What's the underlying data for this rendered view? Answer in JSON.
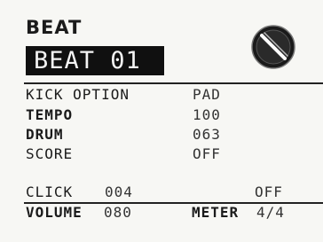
{
  "screen": {
    "title": "BEAT",
    "beat_name": "BEAT 01",
    "knob_icon": "knob-icon"
  },
  "params": [
    {
      "label": "KICK OPTION",
      "value": "PAD"
    },
    {
      "label": "TEMPO",
      "value": "100"
    },
    {
      "label": "DRUM",
      "value": "063"
    },
    {
      "label": "SCORE",
      "value": "OFF"
    }
  ],
  "bottom": {
    "click_label": "CLICK",
    "click_value": "004",
    "click_state": "OFF",
    "volume_label": "VOLUME",
    "volume_value": "080",
    "meter_label": "METER",
    "meter_value": "4/4"
  },
  "colors": {
    "background": "#f7f7f4",
    "text": "#1b1b1b",
    "inverse_bg": "#101010"
  }
}
